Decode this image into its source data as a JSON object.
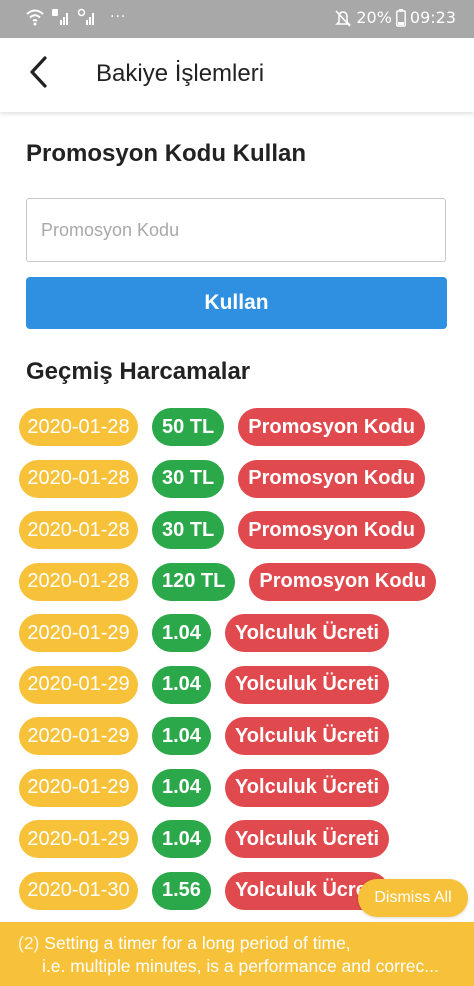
{
  "status_bar": {
    "battery": "20%",
    "time": "09:23",
    "overflow_indicator": "···",
    "icons": [
      "wifi-icon",
      "signal-1-icon",
      "signal-2-icon",
      "mute-icon",
      "battery-icon"
    ]
  },
  "header": {
    "back_icon": "back-chevron-icon",
    "title": "Bakiye İşlemleri"
  },
  "promo": {
    "title": "Promosyon Kodu Kullan",
    "input_placeholder": "Promosyon Kodu",
    "input_value": "",
    "button_label": "Kullan"
  },
  "history": {
    "title": "Geçmiş Harcamalar",
    "items": [
      {
        "date": "2020-01-28",
        "amount": "50 TL",
        "type": "Promosyon Kodu"
      },
      {
        "date": "2020-01-28",
        "amount": "30 TL",
        "type": "Promosyon Kodu"
      },
      {
        "date": "2020-01-28",
        "amount": "30 TL",
        "type": "Promosyon Kodu"
      },
      {
        "date": "2020-01-28",
        "amount": "120 TL",
        "type": "Promosyon Kodu"
      },
      {
        "date": "2020-01-29",
        "amount": "1.04",
        "type": "Yolculuk Ücreti"
      },
      {
        "date": "2020-01-29",
        "amount": "1.04",
        "type": "Yolculuk Ücreti"
      },
      {
        "date": "2020-01-29",
        "amount": "1.04",
        "type": "Yolculuk Ücreti"
      },
      {
        "date": "2020-01-29",
        "amount": "1.04",
        "type": "Yolculuk Ücreti"
      },
      {
        "date": "2020-01-29",
        "amount": "1.04",
        "type": "Yolculuk Ücreti"
      },
      {
        "date": "2020-01-30",
        "amount": "1.56",
        "type": "Yolculuk Ücreti"
      }
    ]
  },
  "warning_banner": {
    "dismiss_label": "Dismiss All",
    "count": "(2)",
    "line1": "Setting a timer for a long period of time,",
    "line2": "i.e. multiple minutes, is a performance and correc..."
  },
  "colors": {
    "status_bar": "#a8a8a8",
    "primary_button": "#2f8fe0",
    "date_chip": "#f7c23a",
    "amount_chip": "#2aa84a",
    "type_chip": "#e04a4e",
    "banner": "#f7c23a"
  }
}
